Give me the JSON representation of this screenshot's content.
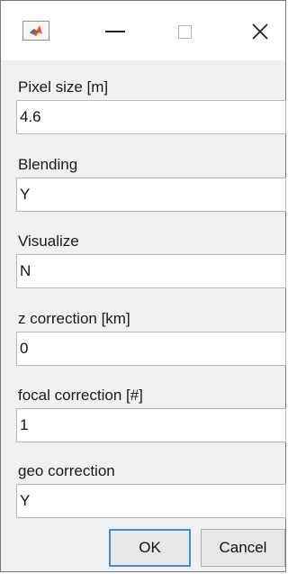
{
  "window": {
    "title": "",
    "controls": {
      "minimize_icon": "minimize-icon",
      "maximize_icon": "maximize-icon",
      "close_icon": "close-icon"
    }
  },
  "fields": [
    {
      "label": "Pixel size [m]",
      "value": "4.6"
    },
    {
      "label": "Blending",
      "value": "Y"
    },
    {
      "label": "Visualize",
      "value": "N"
    },
    {
      "label": "z correction [km]",
      "value": "0"
    },
    {
      "label": "focal correction [#]",
      "value": "1"
    },
    {
      "label": "geo correction",
      "value": "Y"
    }
  ],
  "buttons": {
    "ok_label": "OK",
    "cancel_label": "Cancel"
  },
  "colors": {
    "focus_accent": "#3f8fd8",
    "dialog_background": "#f0f0f0"
  }
}
